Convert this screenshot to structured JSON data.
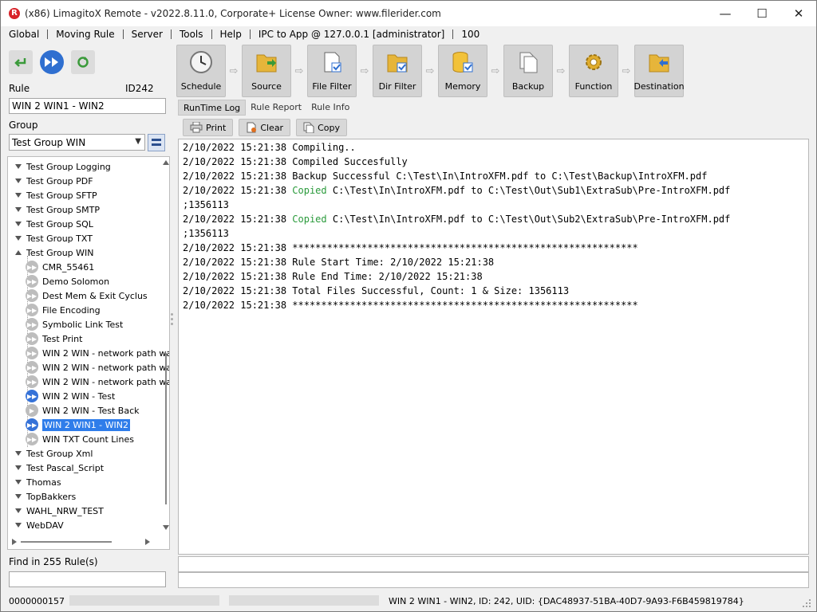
{
  "window": {
    "title": "(x86) LimagitoX Remote - v2022.8.11.0, Corporate+ License Owner: www.filerider.com",
    "controls": {
      "minimize": "—",
      "maximize": "☐",
      "close": "✕"
    }
  },
  "menu": {
    "items": [
      "Global",
      "Moving Rule",
      "Server",
      "Tools",
      "Help",
      "IPC to App @ 127.0.0.1 [administrator]",
      "100"
    ]
  },
  "left": {
    "rule_label": "Rule",
    "rule_id": "ID242",
    "rule_value": "WIN 2 WIN1 - WIN2",
    "group_label": "Group",
    "group_value": "Test Group WIN",
    "find_label": "Find in 255 Rule(s)",
    "find_value": ""
  },
  "tree": {
    "groups_top": [
      "Test Group Logging",
      "Test Group PDF",
      "Test Group SFTP",
      "Test Group SMTP",
      "Test Group SQL",
      "Test Group TXT"
    ],
    "expanded_group": "Test Group WIN",
    "rules": [
      {
        "label": "CMR_55461",
        "state": "grey"
      },
      {
        "label": "Demo Solomon",
        "state": "grey"
      },
      {
        "label": "Dest Mem & Exit Cyclus",
        "state": "grey"
      },
      {
        "label": "File Encoding",
        "state": "grey"
      },
      {
        "label": "Symbolic Link Test",
        "state": "grey"
      },
      {
        "label": "Test Print",
        "state": "grey"
      },
      {
        "label": "WIN 2 WIN - network path wa",
        "state": "grey"
      },
      {
        "label": "WIN 2 WIN - network path wa",
        "state": "grey"
      },
      {
        "label": "WIN 2 WIN - network path wa",
        "state": "grey"
      },
      {
        "label": "WIN 2 WIN - Test",
        "state": "blue"
      },
      {
        "label": "WIN 2 WIN - Test Back",
        "state": "grey"
      },
      {
        "label": "WIN 2 WIN1 - WIN2",
        "state": "blue",
        "selected": true
      },
      {
        "label": "WIN TXT Count Lines",
        "state": "grey"
      }
    ],
    "groups_bottom": [
      "Test Group Xml",
      "Test Pascal_Script",
      "Thomas",
      "TopBakkers",
      "WAHL_NRW_TEST",
      "WebDAV"
    ]
  },
  "toolbar": {
    "buttons": [
      "Schedule",
      "Source",
      "File Filter",
      "Dir Filter",
      "Memory",
      "Backup",
      "Function",
      "Destination"
    ]
  },
  "tabs": [
    "RunTime Log",
    "Rule Report",
    "Rule Info"
  ],
  "actions": {
    "print": "Print",
    "clear": "Clear",
    "copy": "Copy"
  },
  "log": [
    {
      "ts": "2/10/2022 15:21:38",
      "kw": "",
      "text": "Compiling.."
    },
    {
      "ts": "2/10/2022 15:21:38",
      "kw": "",
      "text": "Compiled Succesfully"
    },
    {
      "ts": "2/10/2022 15:21:38",
      "kw": "",
      "text": "Backup Successful C:\\Test\\In\\IntroXFM.pdf to C:\\Test\\Backup\\IntroXFM.pdf"
    },
    {
      "ts": "2/10/2022 15:21:38",
      "kw": "Copied",
      "text": " C:\\Test\\In\\IntroXFM.pdf to C:\\Test\\Out\\Sub1\\ExtraSub\\Pre-IntroXFM.pdf"
    },
    {
      "ts": "",
      "kw": "",
      "text": ";1356113"
    },
    {
      "ts": "2/10/2022 15:21:38",
      "kw": "Copied",
      "text": " C:\\Test\\In\\IntroXFM.pdf to C:\\Test\\Out\\Sub2\\ExtraSub\\Pre-IntroXFM.pdf"
    },
    {
      "ts": "",
      "kw": "",
      "text": ";1356113"
    },
    {
      "ts": "2/10/2022 15:21:38",
      "kw": "",
      "text": "************************************************************"
    },
    {
      "ts": "2/10/2022 15:21:38",
      "kw": "",
      "text": "Rule Start Time: 2/10/2022 15:21:38"
    },
    {
      "ts": "2/10/2022 15:21:38",
      "kw": "",
      "text": "Rule End Time: 2/10/2022 15:21:38"
    },
    {
      "ts": "2/10/2022 15:21:38",
      "kw": "",
      "text": "Total Files Successful, Count: 1 & Size: 1356113"
    },
    {
      "ts": "2/10/2022 15:21:38",
      "kw": "",
      "text": "************************************************************"
    }
  ],
  "status": {
    "counter": "0000000157",
    "info": "WIN 2 WIN1 - WIN2, ID: 242, UID: {DAC48937-51BA-40D7-9A93-F6B459819784}"
  },
  "colors": {
    "accent": "#2f7dea",
    "log_green": "#2a9a3b",
    "toolbar_bg": "#d3d3d3"
  }
}
